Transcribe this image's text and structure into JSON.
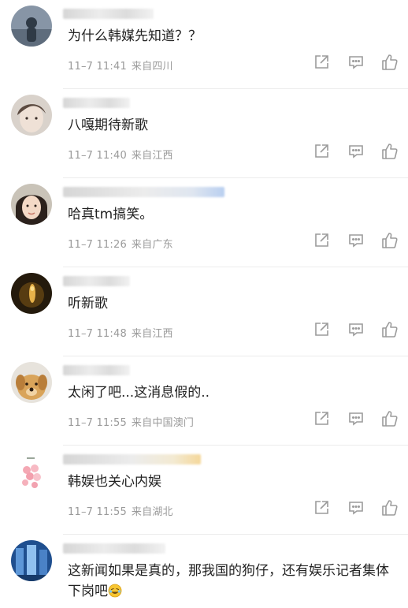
{
  "comments": [
    {
      "text": "为什么韩媒先知道？？",
      "time": "11–7 11:41",
      "location": "来自四川"
    },
    {
      "text": "八嘎期待新歌",
      "time": "11–7 11:40",
      "location": "来自江西"
    },
    {
      "text": "哈真tm搞笑。",
      "time": "11–7 11:26",
      "location": "来自广东"
    },
    {
      "text": "听新歌",
      "time": "11–7 11:48",
      "location": "来自江西"
    },
    {
      "text": "太闲了吧...这消息假的..",
      "time": "11–7 11:55",
      "location": "来自中国澳门"
    },
    {
      "text": "韩娱也关心内娱",
      "time": "11–7 11:55",
      "location": "来自湖北"
    },
    {
      "text": "这新闻如果是真的，那我国的狗仔，还有娱乐记者集体下岗吧",
      "time": "",
      "location": ""
    }
  ],
  "icons": {
    "share": "share-icon",
    "reply": "comment-icon",
    "like": "thumbs-up-icon",
    "emoji": "laughing-emoji-icon"
  },
  "colors": {
    "text": "#222222",
    "meta": "#9a9a9a",
    "icon": "#9b9b9b",
    "divider": "#ececec"
  }
}
